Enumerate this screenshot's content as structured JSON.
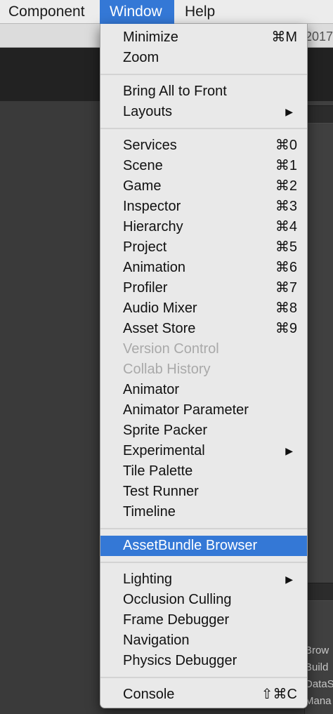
{
  "menubar": {
    "items": [
      {
        "label": "Component"
      },
      {
        "label": "Window"
      },
      {
        "label": "Help"
      }
    ]
  },
  "background": {
    "title_fragment": "2017",
    "side_labels": [
      "Brow",
      "Build",
      "DataS",
      "Mana"
    ]
  },
  "window_menu": {
    "groups": [
      [
        {
          "label": "Minimize",
          "shortcut": "⌘M"
        },
        {
          "label": "Zoom",
          "shortcut": ""
        }
      ],
      [
        {
          "label": "Bring All to Front",
          "shortcut": ""
        },
        {
          "label": "Layouts",
          "submenu": true
        }
      ],
      [
        {
          "label": "Services",
          "shortcut": "⌘0"
        },
        {
          "label": "Scene",
          "shortcut": "⌘1"
        },
        {
          "label": "Game",
          "shortcut": "⌘2"
        },
        {
          "label": "Inspector",
          "shortcut": "⌘3"
        },
        {
          "label": "Hierarchy",
          "shortcut": "⌘4"
        },
        {
          "label": "Project",
          "shortcut": "⌘5"
        },
        {
          "label": "Animation",
          "shortcut": "⌘6"
        },
        {
          "label": "Profiler",
          "shortcut": "⌘7"
        },
        {
          "label": "Audio Mixer",
          "shortcut": "⌘8"
        },
        {
          "label": "Asset Store",
          "shortcut": "⌘9"
        },
        {
          "label": "Version Control",
          "disabled": true
        },
        {
          "label": "Collab History",
          "disabled": true
        },
        {
          "label": "Animator"
        },
        {
          "label": "Animator Parameter"
        },
        {
          "label": "Sprite Packer"
        },
        {
          "label": "Experimental",
          "submenu": true
        },
        {
          "label": "Tile Palette"
        },
        {
          "label": "Test Runner"
        },
        {
          "label": "Timeline"
        }
      ],
      [
        {
          "label": "AssetBundle Browser",
          "selected": true
        }
      ],
      [
        {
          "label": "Lighting",
          "submenu": true
        },
        {
          "label": "Occlusion Culling"
        },
        {
          "label": "Frame Debugger"
        },
        {
          "label": "Navigation"
        },
        {
          "label": "Physics Debugger"
        }
      ],
      [
        {
          "label": "Console",
          "shortcut": "⇧⌘C"
        }
      ]
    ]
  },
  "colors": {
    "selection": "#3478d6",
    "menu_background": "#e9e9e9",
    "disabled_text": "#a9a9a9"
  }
}
